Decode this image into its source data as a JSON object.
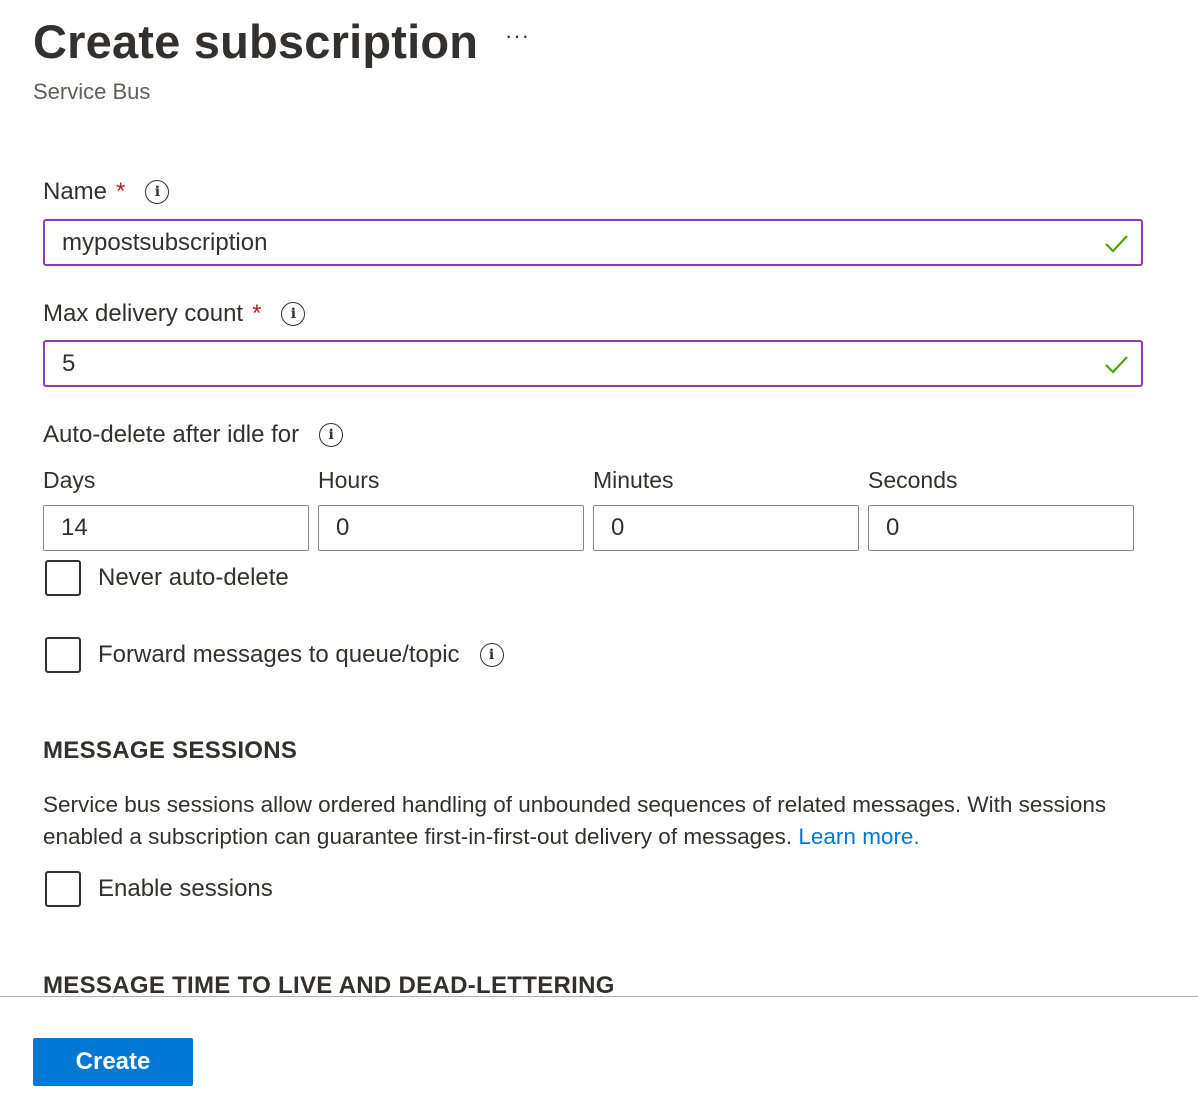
{
  "header": {
    "title": "Create subscription",
    "more_label": "···",
    "subtitle": "Service Bus"
  },
  "form": {
    "name": {
      "label": "Name",
      "required_mark": "*",
      "value": "mypostsubscription",
      "valid": true
    },
    "max_delivery": {
      "label": "Max delivery count",
      "required_mark": "*",
      "value": "5",
      "valid": true
    },
    "auto_delete": {
      "label": "Auto-delete after idle for",
      "days": {
        "label": "Days",
        "value": "14"
      },
      "hours": {
        "label": "Hours",
        "value": "0"
      },
      "minutes": {
        "label": "Minutes",
        "value": "0"
      },
      "seconds": {
        "label": "Seconds",
        "value": "0"
      }
    },
    "never_auto_delete": {
      "label": "Never auto-delete",
      "checked": false
    },
    "forward_messages": {
      "label": "Forward messages to queue/topic",
      "checked": false
    }
  },
  "message_sessions": {
    "title": "MESSAGE SESSIONS",
    "description": "Service bus sessions allow ordered handling of unbounded sequences of related messages. With sessions enabled a subscription can guarantee first-in-first-out delivery of messages.",
    "learn_more": "Learn more.",
    "enable_sessions": {
      "label": "Enable sessions",
      "checked": false
    }
  },
  "ttl_section": {
    "title": "MESSAGE TIME TO LIVE AND DEAD-LETTERING"
  },
  "footer": {
    "create_label": "Create"
  },
  "colors": {
    "accent": "#0078d4",
    "valid_border": "#8a3fab",
    "valid_check": "#57a300",
    "required": "#a4262c"
  },
  "icons": [
    "info-icon",
    "checkmark-icon",
    "more-icon"
  ]
}
